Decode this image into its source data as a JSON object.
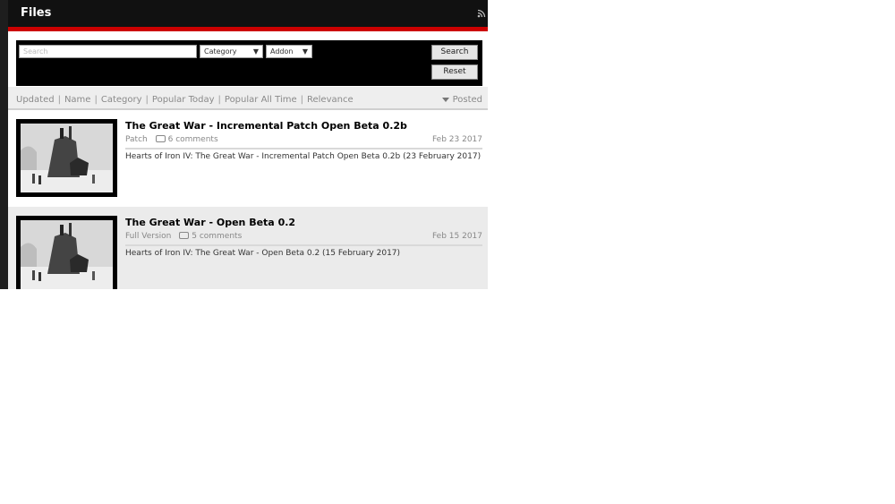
{
  "header": {
    "title": "Files",
    "rss_icon": "rss-icon"
  },
  "filter": {
    "search_placeholder": "Search",
    "category_label": "Category",
    "addon_label": "Addon",
    "arrow": "▼",
    "search_button": "Search",
    "reset_button": "Reset"
  },
  "sort": {
    "links": [
      "Updated",
      "Name",
      "Category",
      "Popular Today",
      "Popular All Time",
      "Relevance"
    ],
    "separator": "|",
    "current": "Posted"
  },
  "items": [
    {
      "title": "The Great War - Incremental Patch Open Beta 0.2b",
      "type": "Patch",
      "comments": "6 comments",
      "date": "Feb 23 2017",
      "description": "Hearts of Iron IV: The Great War - Incremental Patch Open Beta 0.2b (23 February 2017)"
    },
    {
      "title": "The Great War - Open Beta 0.2",
      "type": "Full Version",
      "comments": "5 comments",
      "date": "Feb 15 2017",
      "description": "Hearts of Iron IV: The Great War - Open Beta 0.2 (15 February 2017)"
    }
  ],
  "colors": {
    "accent_red": "#cc0000",
    "header_bg": "#111111",
    "row_alt_bg": "#ebebeb"
  }
}
